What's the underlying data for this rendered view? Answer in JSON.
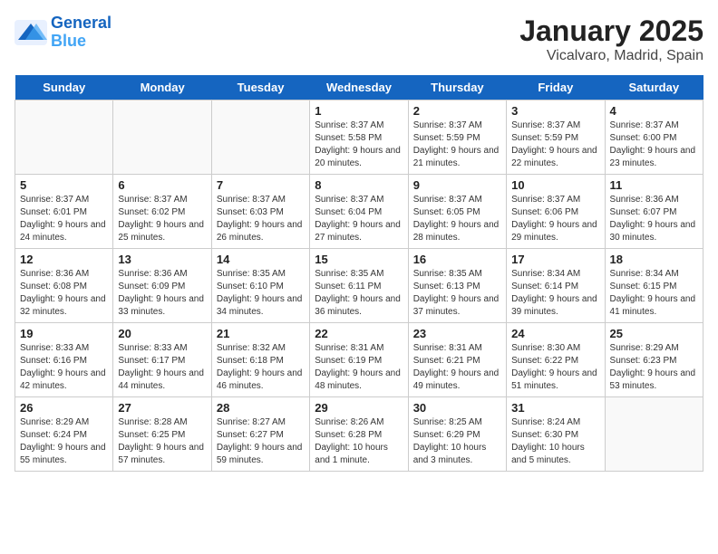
{
  "logo": {
    "line1": "General",
    "line2": "Blue"
  },
  "header": {
    "month": "January 2025",
    "location": "Vicalvaro, Madrid, Spain"
  },
  "weekdays": [
    "Sunday",
    "Monday",
    "Tuesday",
    "Wednesday",
    "Thursday",
    "Friday",
    "Saturday"
  ],
  "weeks": [
    [
      {
        "day": "",
        "detail": ""
      },
      {
        "day": "",
        "detail": ""
      },
      {
        "day": "",
        "detail": ""
      },
      {
        "day": "1",
        "detail": "Sunrise: 8:37 AM\nSunset: 5:58 PM\nDaylight: 9 hours\nand 20 minutes."
      },
      {
        "day": "2",
        "detail": "Sunrise: 8:37 AM\nSunset: 5:59 PM\nDaylight: 9 hours\nand 21 minutes."
      },
      {
        "day": "3",
        "detail": "Sunrise: 8:37 AM\nSunset: 5:59 PM\nDaylight: 9 hours\nand 22 minutes."
      },
      {
        "day": "4",
        "detail": "Sunrise: 8:37 AM\nSunset: 6:00 PM\nDaylight: 9 hours\nand 23 minutes."
      }
    ],
    [
      {
        "day": "5",
        "detail": "Sunrise: 8:37 AM\nSunset: 6:01 PM\nDaylight: 9 hours\nand 24 minutes."
      },
      {
        "day": "6",
        "detail": "Sunrise: 8:37 AM\nSunset: 6:02 PM\nDaylight: 9 hours\nand 25 minutes."
      },
      {
        "day": "7",
        "detail": "Sunrise: 8:37 AM\nSunset: 6:03 PM\nDaylight: 9 hours\nand 26 minutes."
      },
      {
        "day": "8",
        "detail": "Sunrise: 8:37 AM\nSunset: 6:04 PM\nDaylight: 9 hours\nand 27 minutes."
      },
      {
        "day": "9",
        "detail": "Sunrise: 8:37 AM\nSunset: 6:05 PM\nDaylight: 9 hours\nand 28 minutes."
      },
      {
        "day": "10",
        "detail": "Sunrise: 8:37 AM\nSunset: 6:06 PM\nDaylight: 9 hours\nand 29 minutes."
      },
      {
        "day": "11",
        "detail": "Sunrise: 8:36 AM\nSunset: 6:07 PM\nDaylight: 9 hours\nand 30 minutes."
      }
    ],
    [
      {
        "day": "12",
        "detail": "Sunrise: 8:36 AM\nSunset: 6:08 PM\nDaylight: 9 hours\nand 32 minutes."
      },
      {
        "day": "13",
        "detail": "Sunrise: 8:36 AM\nSunset: 6:09 PM\nDaylight: 9 hours\nand 33 minutes."
      },
      {
        "day": "14",
        "detail": "Sunrise: 8:35 AM\nSunset: 6:10 PM\nDaylight: 9 hours\nand 34 minutes."
      },
      {
        "day": "15",
        "detail": "Sunrise: 8:35 AM\nSunset: 6:11 PM\nDaylight: 9 hours\nand 36 minutes."
      },
      {
        "day": "16",
        "detail": "Sunrise: 8:35 AM\nSunset: 6:13 PM\nDaylight: 9 hours\nand 37 minutes."
      },
      {
        "day": "17",
        "detail": "Sunrise: 8:34 AM\nSunset: 6:14 PM\nDaylight: 9 hours\nand 39 minutes."
      },
      {
        "day": "18",
        "detail": "Sunrise: 8:34 AM\nSunset: 6:15 PM\nDaylight: 9 hours\nand 41 minutes."
      }
    ],
    [
      {
        "day": "19",
        "detail": "Sunrise: 8:33 AM\nSunset: 6:16 PM\nDaylight: 9 hours\nand 42 minutes."
      },
      {
        "day": "20",
        "detail": "Sunrise: 8:33 AM\nSunset: 6:17 PM\nDaylight: 9 hours\nand 44 minutes."
      },
      {
        "day": "21",
        "detail": "Sunrise: 8:32 AM\nSunset: 6:18 PM\nDaylight: 9 hours\nand 46 minutes."
      },
      {
        "day": "22",
        "detail": "Sunrise: 8:31 AM\nSunset: 6:19 PM\nDaylight: 9 hours\nand 48 minutes."
      },
      {
        "day": "23",
        "detail": "Sunrise: 8:31 AM\nSunset: 6:21 PM\nDaylight: 9 hours\nand 49 minutes."
      },
      {
        "day": "24",
        "detail": "Sunrise: 8:30 AM\nSunset: 6:22 PM\nDaylight: 9 hours\nand 51 minutes."
      },
      {
        "day": "25",
        "detail": "Sunrise: 8:29 AM\nSunset: 6:23 PM\nDaylight: 9 hours\nand 53 minutes."
      }
    ],
    [
      {
        "day": "26",
        "detail": "Sunrise: 8:29 AM\nSunset: 6:24 PM\nDaylight: 9 hours\nand 55 minutes."
      },
      {
        "day": "27",
        "detail": "Sunrise: 8:28 AM\nSunset: 6:25 PM\nDaylight: 9 hours\nand 57 minutes."
      },
      {
        "day": "28",
        "detail": "Sunrise: 8:27 AM\nSunset: 6:27 PM\nDaylight: 9 hours\nand 59 minutes."
      },
      {
        "day": "29",
        "detail": "Sunrise: 8:26 AM\nSunset: 6:28 PM\nDaylight: 10 hours\nand 1 minute."
      },
      {
        "day": "30",
        "detail": "Sunrise: 8:25 AM\nSunset: 6:29 PM\nDaylight: 10 hours\nand 3 minutes."
      },
      {
        "day": "31",
        "detail": "Sunrise: 8:24 AM\nSunset: 6:30 PM\nDaylight: 10 hours\nand 5 minutes."
      },
      {
        "day": "",
        "detail": ""
      }
    ]
  ]
}
